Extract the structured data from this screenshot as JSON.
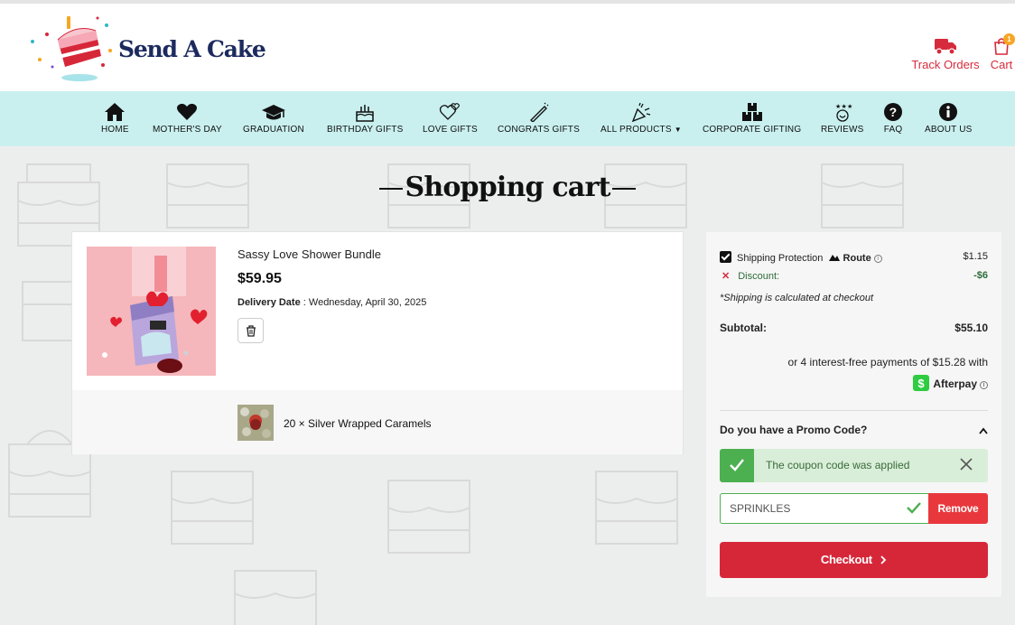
{
  "brand": {
    "name": "Send A Cake"
  },
  "header": {
    "track_orders": "Track Orders",
    "cart": "Cart",
    "cart_count": "1"
  },
  "nav": {
    "home": "HOME",
    "mothers_day": "MOTHER'S DAY",
    "graduation": "GRADUATION",
    "birthday_gifts": "BIRTHDAY GIFTS",
    "love_gifts": "LOVE GIFTS",
    "congrats_gifts": "CONGRATS GIFTS",
    "all_products": "ALL PRODUCTS",
    "corporate_gifting": "CORPORATE GIFTING",
    "reviews": "REVIEWS",
    "faq": "FAQ",
    "about_us": "ABOUT US"
  },
  "page": {
    "title": "Shopping cart"
  },
  "cart_item": {
    "name": "Sassy Love Shower Bundle",
    "price": "$59.95",
    "delivery_label": "Delivery Date",
    "delivery_sep": " : ",
    "delivery_value": "Wednesday, April 30, 2025",
    "addon_text": "20 ×  Silver Wrapped Caramels"
  },
  "summary": {
    "shipping_protection": "Shipping Protection",
    "route": "Route",
    "shipping_protection_price": "$1.15",
    "discount_label": "Discount:",
    "discount_value": "-$6",
    "shipping_note": "*Shipping is calculated at checkout",
    "subtotal_label": "Subtotal:",
    "subtotal_value": "$55.10",
    "afterpay_text": "or 4 interest-free payments of $15.28 with",
    "afterpay_brand": "Afterpay",
    "promo_question": "Do you have a Promo Code?",
    "coupon_msg": "The coupon code was applied",
    "coupon_code": "SPRINKLES",
    "remove": "Remove",
    "checkout": "Checkout"
  },
  "colors": {
    "brand_red": "#d62739",
    "nav_bg": "#c9f0ef",
    "success_green": "#4caf50",
    "navy": "#1c2a5e"
  }
}
